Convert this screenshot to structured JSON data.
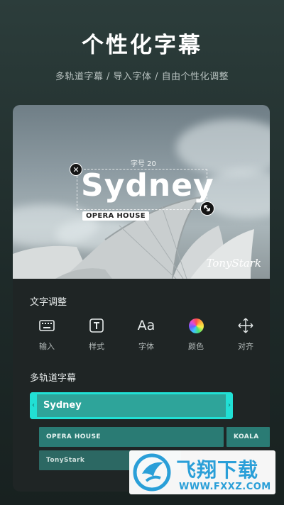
{
  "header": {
    "title": "个性化字幕",
    "subtitle": "多轨道字幕 / 导入字体 / 自由个性化调整"
  },
  "preview": {
    "size_label": "字号 20",
    "main_text": "Sydney",
    "tag_text": "OPERA HOUSE",
    "signature": "TonyStark"
  },
  "text_adjust": {
    "title": "文字调整",
    "tools": [
      {
        "label": "输入",
        "icon": "keyboard-icon"
      },
      {
        "label": "样式",
        "icon": "text-style-icon"
      },
      {
        "label": "字体",
        "icon": "font-icon",
        "glyph": "Aa"
      },
      {
        "label": "颜色",
        "icon": "color-wheel-icon"
      },
      {
        "label": "对齐",
        "icon": "align-move-icon"
      }
    ]
  },
  "tracks": {
    "title": "多轨道字幕",
    "main": "Sydney",
    "row2": [
      "OPERA HOUSE",
      "KOALA"
    ],
    "row3": [
      "TonyStark"
    ]
  },
  "watermark": {
    "cn": "飞翔下载",
    "url": "WWW.FXXZ.COM"
  },
  "colors": {
    "accent": "#21e0d5",
    "track": "#2a7b74",
    "background": "#1e2a29",
    "watermark_blue": "#2a9fd8"
  }
}
